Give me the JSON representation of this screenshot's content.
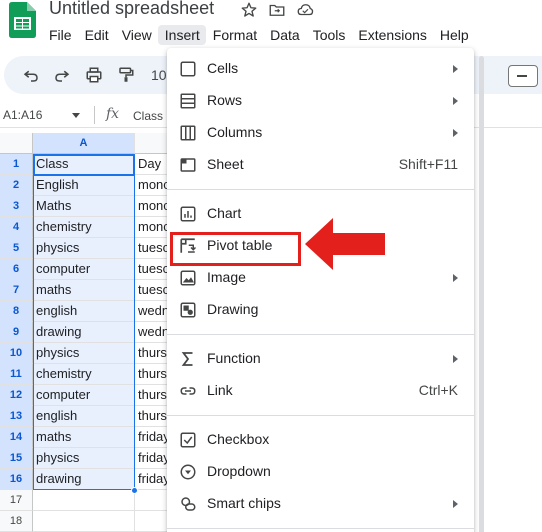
{
  "app": {
    "title": "Untitled spreadsheet"
  },
  "menubar": {
    "items": [
      {
        "label": "File"
      },
      {
        "label": "Edit"
      },
      {
        "label": "View"
      },
      {
        "label": "Insert"
      },
      {
        "label": "Format"
      },
      {
        "label": "Data"
      },
      {
        "label": "Tools"
      },
      {
        "label": "Extensions"
      },
      {
        "label": "Help"
      }
    ]
  },
  "toolbar": {
    "zoom": "10"
  },
  "formula_bar": {
    "name_box": "A1:A16",
    "fx": "fx",
    "content": "Class"
  },
  "grid": {
    "col_a_header": "A",
    "rows": [
      {
        "n": "1",
        "a": "Class",
        "b": "Day"
      },
      {
        "n": "2",
        "a": "English",
        "b": "monc"
      },
      {
        "n": "3",
        "a": "Maths",
        "b": "monc"
      },
      {
        "n": "4",
        "a": "chemistry",
        "b": "monc"
      },
      {
        "n": "5",
        "a": "physics",
        "b": "tuesc"
      },
      {
        "n": "6",
        "a": "computer",
        "b": "tuesc"
      },
      {
        "n": "7",
        "a": "maths",
        "b": "tuesc"
      },
      {
        "n": "8",
        "a": "english",
        "b": "wedn"
      },
      {
        "n": "9",
        "a": "drawing",
        "b": "wedn"
      },
      {
        "n": "10",
        "a": "physics",
        "b": "thurs"
      },
      {
        "n": "11",
        "a": "chemistry",
        "b": "thurs"
      },
      {
        "n": "12",
        "a": "computer",
        "b": "thurs"
      },
      {
        "n": "13",
        "a": "english",
        "b": "thurs"
      },
      {
        "n": "14",
        "a": "maths",
        "b": "friday"
      },
      {
        "n": "15",
        "a": "physics",
        "b": "friday"
      },
      {
        "n": "16",
        "a": "drawing",
        "b": "friday"
      },
      {
        "n": "17",
        "a": "",
        "b": ""
      },
      {
        "n": "18",
        "a": "",
        "b": ""
      }
    ]
  },
  "insert_menu": {
    "items": [
      {
        "label": "Cells",
        "icon": "cells-icon",
        "submenu": true
      },
      {
        "label": "Rows",
        "icon": "rows-icon",
        "submenu": true
      },
      {
        "label": "Columns",
        "icon": "columns-icon",
        "submenu": true
      },
      {
        "label": "Sheet",
        "icon": "sheet-icon",
        "shortcut": "Shift+F11"
      },
      {
        "label": "Chart",
        "icon": "chart-icon"
      },
      {
        "label": "Pivot table",
        "icon": "pivot-table-icon"
      },
      {
        "label": "Image",
        "icon": "image-icon",
        "submenu": true
      },
      {
        "label": "Drawing",
        "icon": "drawing-icon"
      },
      {
        "label": "Function",
        "icon": "sigma-icon",
        "submenu": true
      },
      {
        "label": "Link",
        "icon": "link-icon",
        "shortcut": "Ctrl+K"
      },
      {
        "label": "Checkbox",
        "icon": "checkbox-icon"
      },
      {
        "label": "Dropdown",
        "icon": "dropdown-icon"
      },
      {
        "label": "Smart chips",
        "icon": "smart-chips-icon",
        "submenu": true
      }
    ]
  },
  "colors": {
    "accent": "#1a73e8",
    "selection_fill": "#e8f0fe",
    "annotation_red": "#e3201c",
    "sheets_green": "#0f9d58"
  }
}
